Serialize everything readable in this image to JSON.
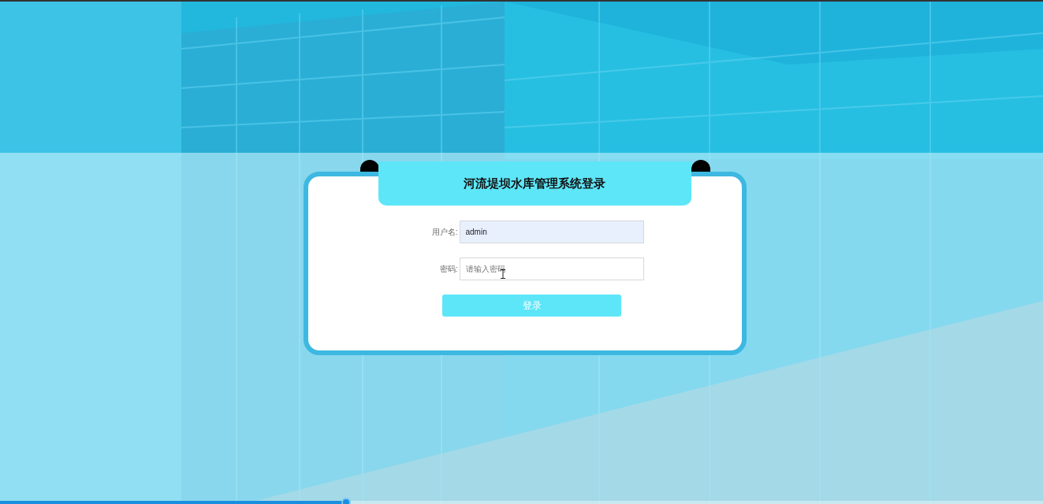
{
  "login_card": {
    "title": "河流堤坝水库管理系统登录",
    "fields": [
      {
        "label": "用户名:",
        "value": "admin",
        "autofilled": true
      },
      {
        "label": "密码:",
        "placeholder": "请输入密码",
        "autofilled": false
      }
    ],
    "button": "登录"
  },
  "seek_bar": {
    "level": 0.332
  }
}
